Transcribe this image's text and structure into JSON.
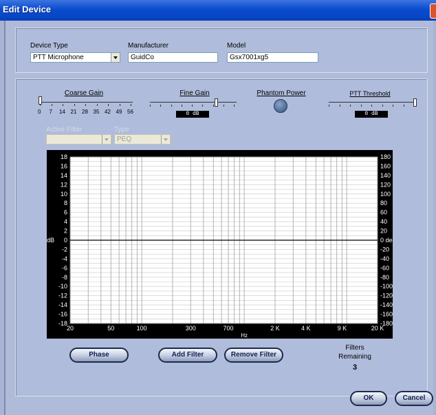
{
  "window": {
    "title": "Edit Device"
  },
  "device": {
    "type_label": "Device Type",
    "type_value": "PTT Microphone",
    "manufacturer_label": "Manufacturer",
    "manufacturer_value": "GuidCo",
    "model_label": "Model",
    "model_value": "Gsx7001xg5"
  },
  "controls": {
    "coarse_gain_label": "Coarse Gain",
    "coarse_gain_scale": [
      "0",
      "7",
      "14",
      "21",
      "28",
      "35",
      "42",
      "49",
      "56"
    ],
    "coarse_gain_value": 0,
    "fine_gain_label": "Fine Gain",
    "fine_gain_value": "0 dB",
    "phantom_power_label": "Phantom Power",
    "ptt_threshold_label": "PTT Threshold",
    "ptt_threshold_value": "0 dB"
  },
  "filter": {
    "active_label": "Active Filter",
    "active_value": "",
    "type_label": "Type",
    "type_value": "PEQ"
  },
  "graph": {
    "left_axis_label": "dB",
    "right_axis_unit": "deg.",
    "x_axis_label": "Hz",
    "left_ticks": [
      "18",
      "16",
      "14",
      "12",
      "10",
      "8",
      "6",
      "4",
      "2",
      "0",
      "-2",
      "-4",
      "-6",
      "-8",
      "-10",
      "-12",
      "-14",
      "-16",
      "-18"
    ],
    "right_ticks": [
      "180",
      "160",
      "140",
      "120",
      "100",
      "80",
      "60",
      "40",
      "20",
      "0",
      "-20",
      "-40",
      "-60",
      "-80",
      "-100",
      "-120",
      "-140",
      "-160",
      "-180"
    ],
    "x_ticks": [
      "20",
      "50",
      "100",
      "300",
      "700",
      "2 K",
      "4 K",
      "9 K",
      "20 K"
    ],
    "x_tick_freqs": [
      20,
      50,
      100,
      300,
      700,
      2000,
      4000,
      9000,
      20000
    ],
    "response_db": 0,
    "colors": {
      "background": "#000000",
      "plot": "#ffffff",
      "grid": "#c8c8c8",
      "line": "#000000"
    }
  },
  "buttons": {
    "phase": "Phase",
    "add_filter": "Add Filter",
    "remove_filter": "Remove Filter",
    "ok": "OK",
    "cancel": "Cancel"
  },
  "filters_remaining": {
    "label_line1": "Filters",
    "label_line2": "Remaining",
    "count": "3"
  }
}
